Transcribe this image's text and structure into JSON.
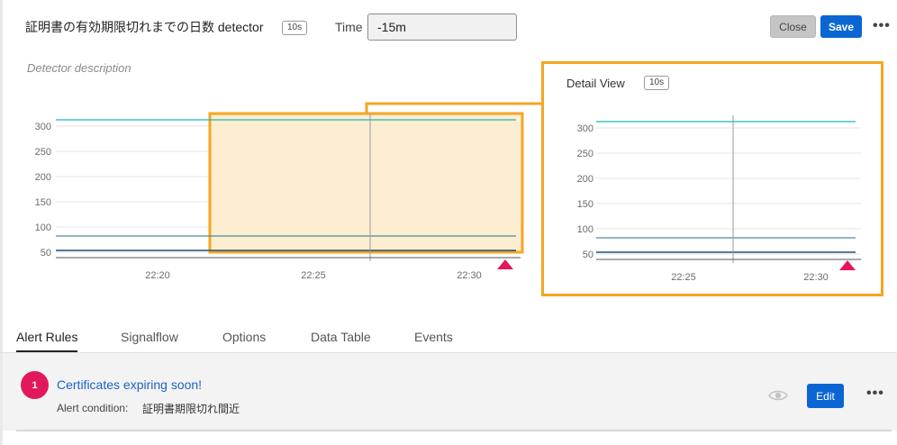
{
  "header": {
    "title": "証明書の有効期限切れまでの日数 detector",
    "resolution_badge": "10s",
    "time_label": "Time",
    "time_value": "-15m",
    "close_label": "Close",
    "save_label": "Save",
    "more_label": "•••"
  },
  "description_placeholder": "Detector description",
  "main_chart": {
    "y_ticks": [
      "300",
      "250",
      "200",
      "150",
      "100",
      "50"
    ],
    "x_ticks": [
      "22:20",
      "22:25",
      "22:30"
    ]
  },
  "detail_view": {
    "title": "Detail View",
    "resolution_badge": "10s",
    "y_ticks": [
      "300",
      "250",
      "200",
      "150",
      "100",
      "50"
    ],
    "x_ticks": [
      "22:25",
      "22:30"
    ]
  },
  "tabs": [
    "Alert Rules",
    "Signalflow",
    "Options",
    "Data Table",
    "Events"
  ],
  "alert_rule": {
    "number": "1",
    "name": "Certificates expiring soon!",
    "condition_label": "Alert condition:",
    "condition_value": "証明書期限切れ間近",
    "edit_label": "Edit",
    "more_label": "•••"
  },
  "colors": {
    "accent_blue": "#0b66d4",
    "alert_red": "#e2185b",
    "selection_orange": "#f5a623",
    "series_teal": "#22b5b5",
    "series_slate": "#4e8aa3",
    "series_navy": "#1d4f7a"
  },
  "icons": [
    "more-icon",
    "alert-triangle-icon",
    "eye-icon"
  ]
}
